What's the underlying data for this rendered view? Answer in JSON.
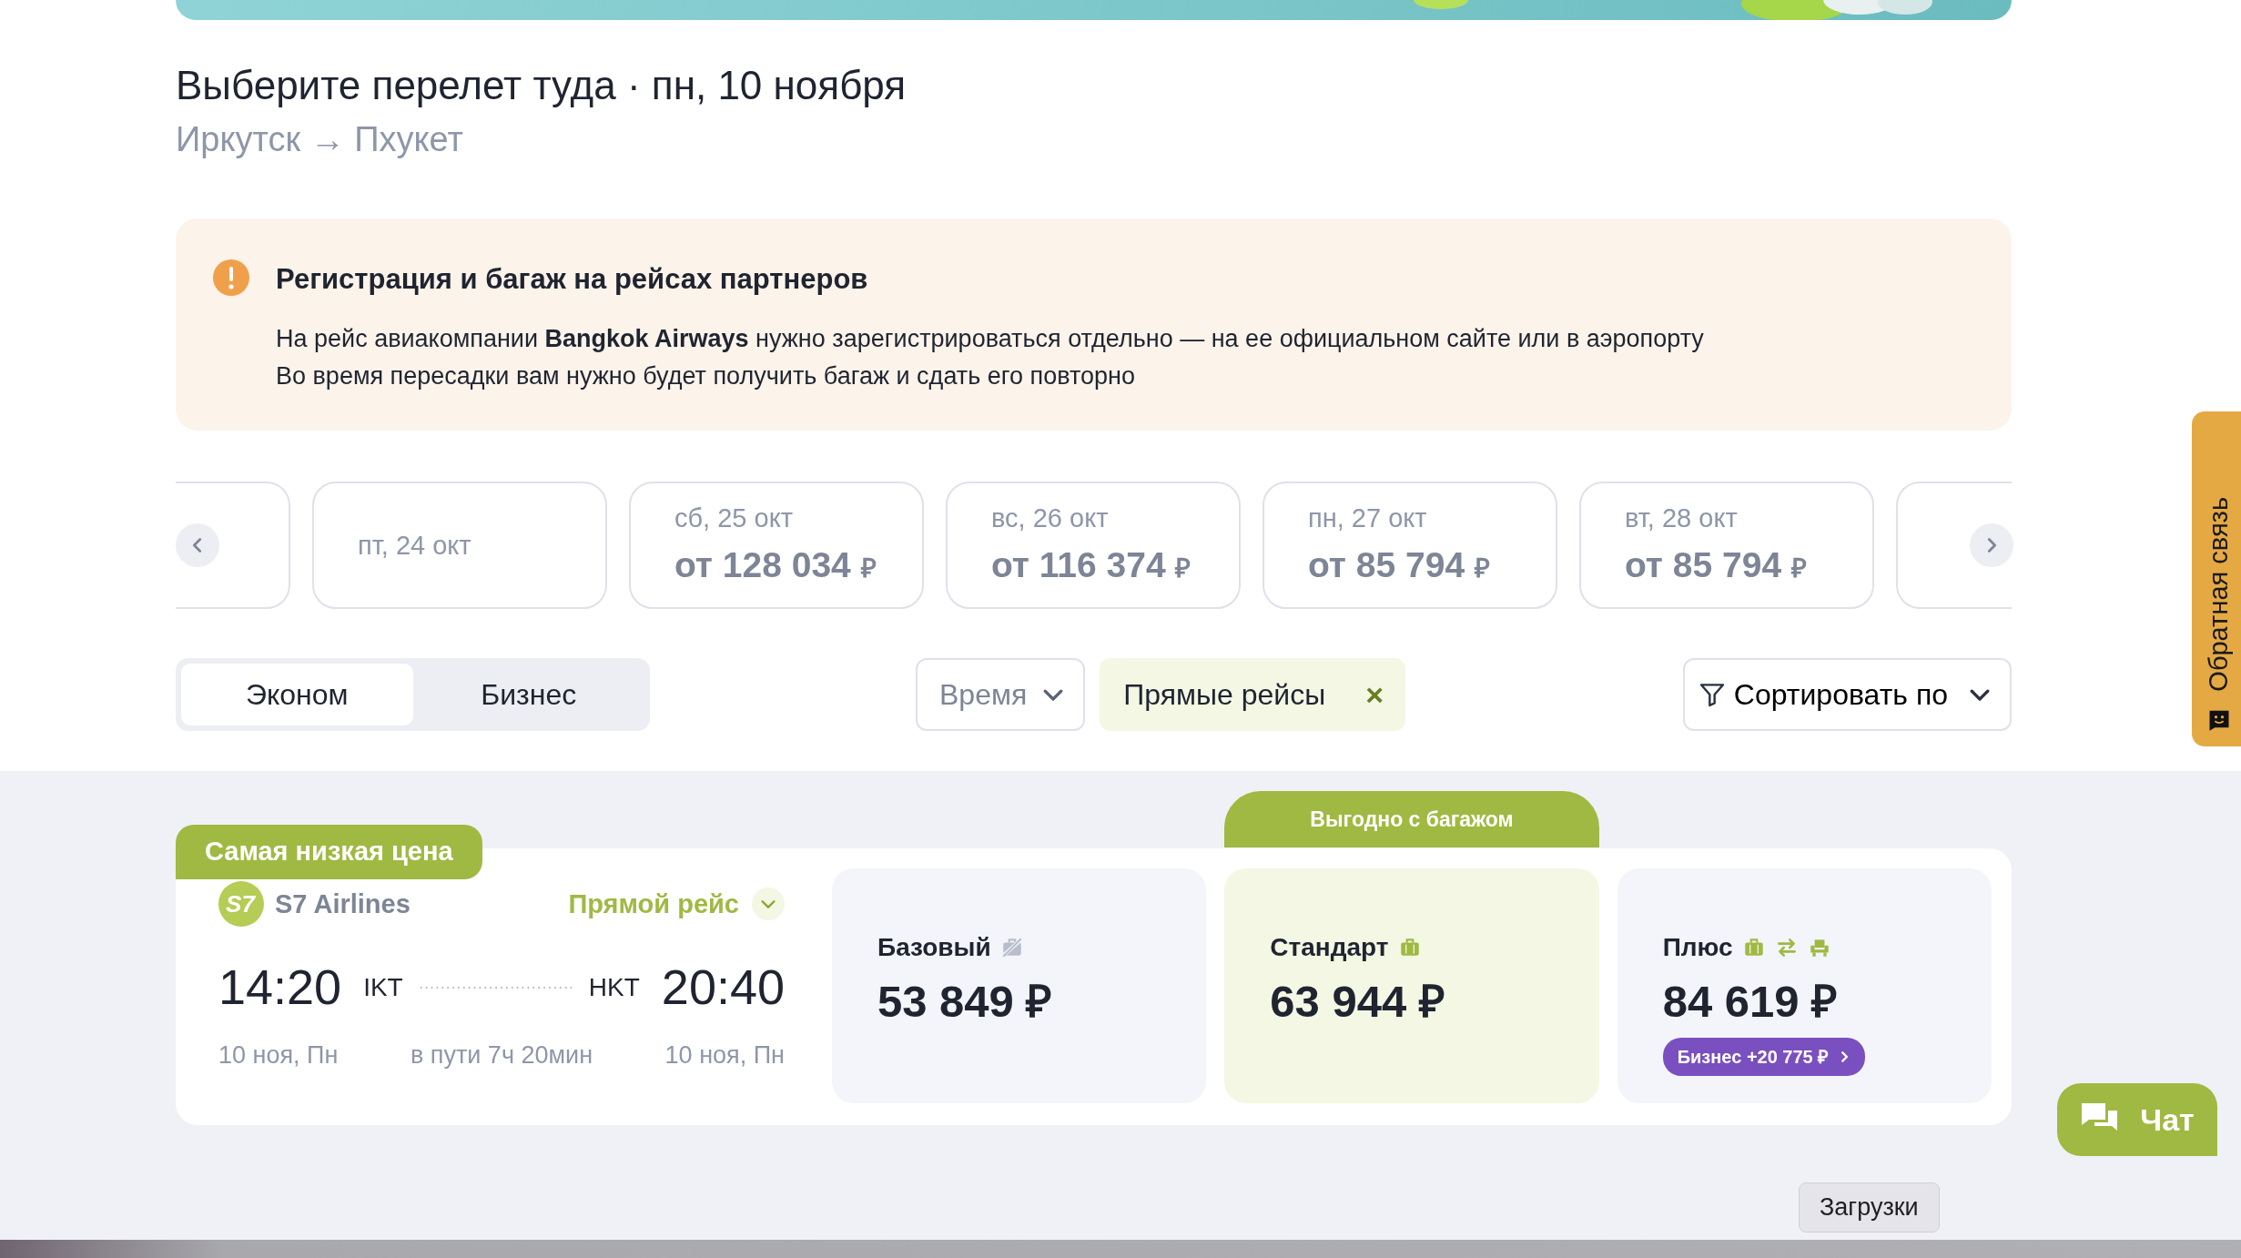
{
  "heading": {
    "title": "Выберите перелет туда · пн, 10 ноября",
    "route": "Иркутск → Пхукет"
  },
  "alert": {
    "title": "Регистрация и багаж на рейсах партнеров",
    "lines": [
      "На рейс авиакомпании **Bangkok Airways** нужно зарегистрироваться отдельно — на ее официальном сайте или в аэропорту",
      "Во время пересадки вам нужно будет получить багаж и сдать его повторно"
    ]
  },
  "dates": [
    {
      "label": "пт, 24 окт"
    },
    {
      "label": "сб, 25 окт",
      "price": "от 128 034",
      "currency": "₽"
    },
    {
      "label": "вс, 26 окт",
      "price": "от 116 374",
      "currency": "₽"
    },
    {
      "label": "пн, 27 окт",
      "price": "от 85 794",
      "currency": "₽"
    },
    {
      "label": "вт, 28 окт",
      "price": "от 85 794",
      "currency": "₽"
    }
  ],
  "cabin_classes": [
    {
      "label": "Эконом",
      "selected": true
    },
    {
      "label": "Бизнес",
      "selected": false
    }
  ],
  "filters": {
    "time": "Время",
    "chip": {
      "label": "Прямые рейсы",
      "remove": "×"
    },
    "sort": "Сортировать по"
  },
  "flight": {
    "badge": "Самая низкая цена",
    "logo_text": "S7",
    "airline": "S7 Airlines",
    "stops": "Прямой рейс",
    "departure": {
      "time": "14:20",
      "code": "IKT",
      "date": "10 ноя, Пн"
    },
    "arrival": {
      "time": "20:40",
      "code": "HKT",
      "date": "10 ноя, Пн"
    },
    "duration": "в пути 7ч 20мин",
    "fares": [
      {
        "name": "Базовый",
        "price": "53 849 ₽",
        "highlighted": false,
        "features": [
          {
            "kind": "no-baggage"
          }
        ]
      },
      {
        "name": "Стандарт",
        "price": "63 944 ₽",
        "highlighted": true,
        "ribbon": "Выгодно с багажом",
        "features": [
          {
            "kind": "baggage"
          }
        ]
      },
      {
        "name": "Плюс",
        "price": "84 619 ₽",
        "highlighted": false,
        "features": [
          {
            "kind": "baggage"
          },
          {
            "kind": "exchange"
          },
          {
            "kind": "seat"
          }
        ],
        "upgrade": "Бизнес +20 775 ₽"
      }
    ]
  },
  "feedback": "Обратная связь",
  "chat": "Чат",
  "tooltip": "Загрузки"
}
